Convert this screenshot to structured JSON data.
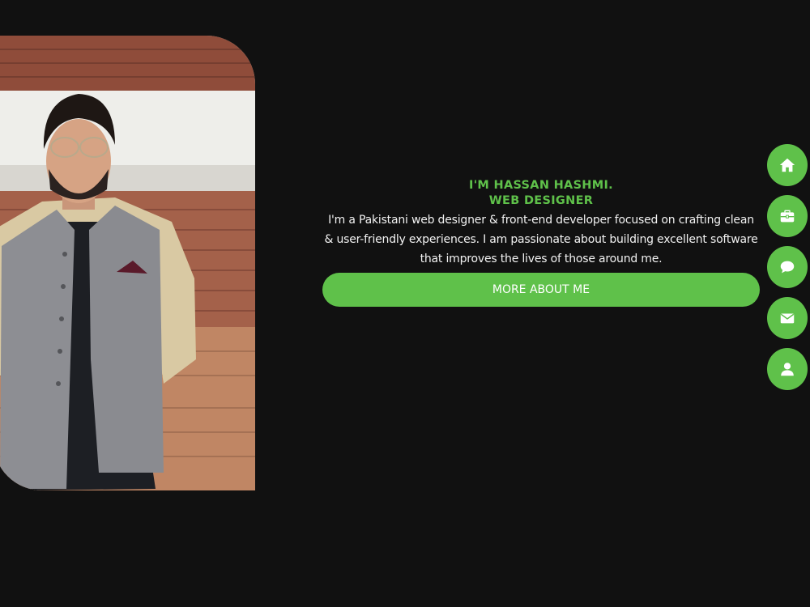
{
  "intro": {
    "name": "I'M HASSAN HASHMI.",
    "role": "WEB DESIGNER",
    "bio": "I'm a Pakistani web designer & front-end developer focused on crafting clean & user-friendly experiences. I am passionate about building excellent software that improves the lives of those around me.",
    "button_label": "MORE ABOUT ME"
  },
  "side_nav": {
    "items": [
      {
        "icon": "home-icon"
      },
      {
        "icon": "briefcase-icon"
      },
      {
        "icon": "chat-icon"
      },
      {
        "icon": "mail-icon"
      },
      {
        "icon": "user-icon"
      }
    ]
  },
  "colors": {
    "background": "#111111",
    "accent": "#5fc14a",
    "text": "#f2f2f2"
  }
}
